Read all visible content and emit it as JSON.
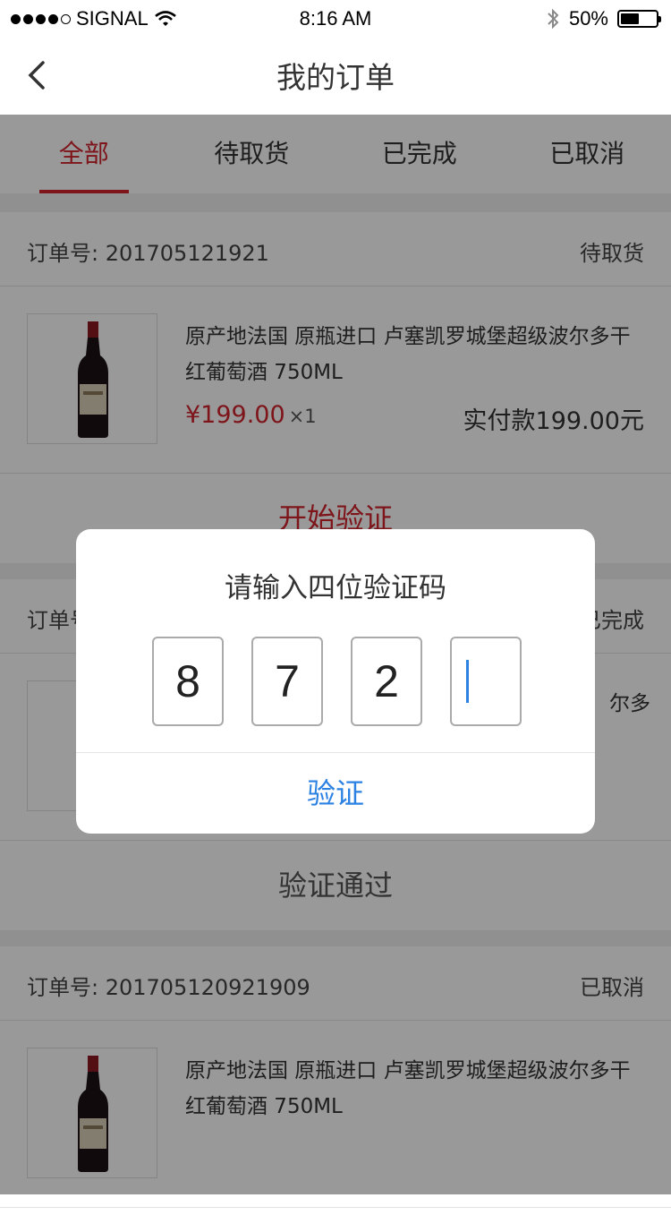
{
  "status_bar": {
    "carrier": "SIGNAL",
    "time": "8:16 AM",
    "battery_percent": "50%",
    "battery_level": 0.5,
    "icons": [
      "signal-dots",
      "wifi-icon",
      "bluetooth-icon",
      "battery-icon"
    ]
  },
  "nav": {
    "title": "我的订单",
    "back_icon": "chevron-left-icon"
  },
  "tabs": [
    {
      "label": "全部",
      "active": true
    },
    {
      "label": "待取货",
      "active": false
    },
    {
      "label": "已完成",
      "active": false
    },
    {
      "label": "已取消",
      "active": false
    }
  ],
  "orders": [
    {
      "number": "订单号: 201705121921",
      "status": "待取货",
      "product_name": "原产地法国  原瓶进口  卢塞凯罗城堡超级波尔多干红葡萄酒   750ML",
      "price": "¥199.00",
      "quantity": "×1",
      "paid": "实付款199.00元",
      "action": "开始验证"
    },
    {
      "number": "订单号",
      "status": "已完成",
      "product_name": "尔多",
      "action": "验证通过"
    },
    {
      "number": "订单号: 201705120921909",
      "status": "已取消",
      "product_name": "原产地法国  原瓶进口  卢塞凯罗城堡超级波尔多干红葡萄酒   750ML"
    }
  ],
  "dialog": {
    "title": "请输入四位验证码",
    "digits": [
      "8",
      "7",
      "2",
      ""
    ],
    "confirm_label": "验证"
  },
  "colors": {
    "accent_red": "#d0242d",
    "link_blue": "#2b82e3"
  }
}
